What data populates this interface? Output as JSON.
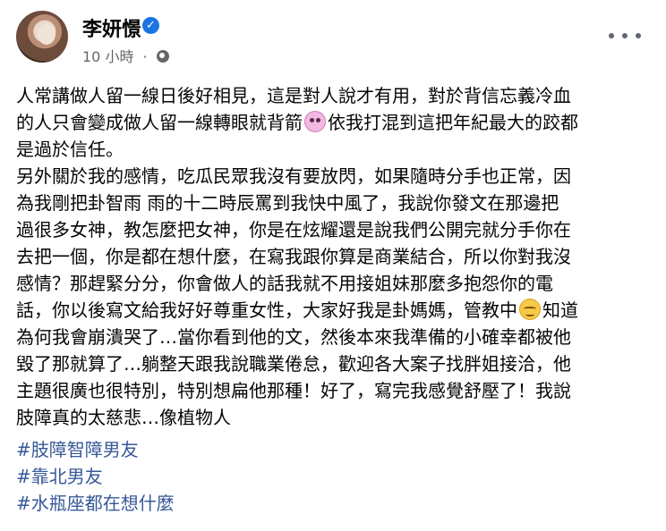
{
  "post": {
    "author": "李妍憬",
    "time": "10 小時",
    "separator": "·",
    "lines": [
      "人常講做人留一線日後好相見，這是對人說才有用，對於背信忘義冷血",
      "的人只會變成做人留一線轉眼就背箭",
      "依我打混到這把年紀最大的跤都",
      "是過於信任。",
      "另外關於我的感情，吃瓜民眾我沒有要放閃，如果隨時分手也正常，因",
      "為我剛把卦智雨 雨的十二時辰罵到我快中風了，我說你發文在那邊把",
      "過很多女神，教怎麼把女神，你是在炫耀還是說我們公開完就分手你在",
      "去把一個，你是都在想什麼，在寫我跟你算是商業結合，所以你對我沒",
      "感情？那趕緊分分，你會做人的話我就不用接姐妹那麼多抱怨你的電",
      "話，你以後寫文給我好好尊重女性，大家好我是卦媽媽，管教中",
      "知道",
      "為何我會崩潰哭了…當你看到他的文，然後本來我準備的小確幸都被他",
      "毀了那就算了…躺整天跟我說職業倦怠，歡迎各大案子找胖姐接洽，他",
      "主題很廣也很特別，特別想扁他那種！好了，寫完我感覺舒壓了！我說",
      "肢障真的太慈悲…像植物人"
    ],
    "hashtags": [
      "#肢障智障男友",
      "#靠北男友",
      "#水瓶座都在想什麼"
    ]
  },
  "icons": {
    "verified": "verified-badge-icon",
    "privacy": "globe-icon",
    "more": "more-options-icon",
    "emoji1": "sick-face-emoji",
    "emoji2": "relieved-face-emoji"
  },
  "colors": {
    "verified": "#1b74e4",
    "hashtag": "#385898",
    "secondary_text": "#65676b"
  }
}
